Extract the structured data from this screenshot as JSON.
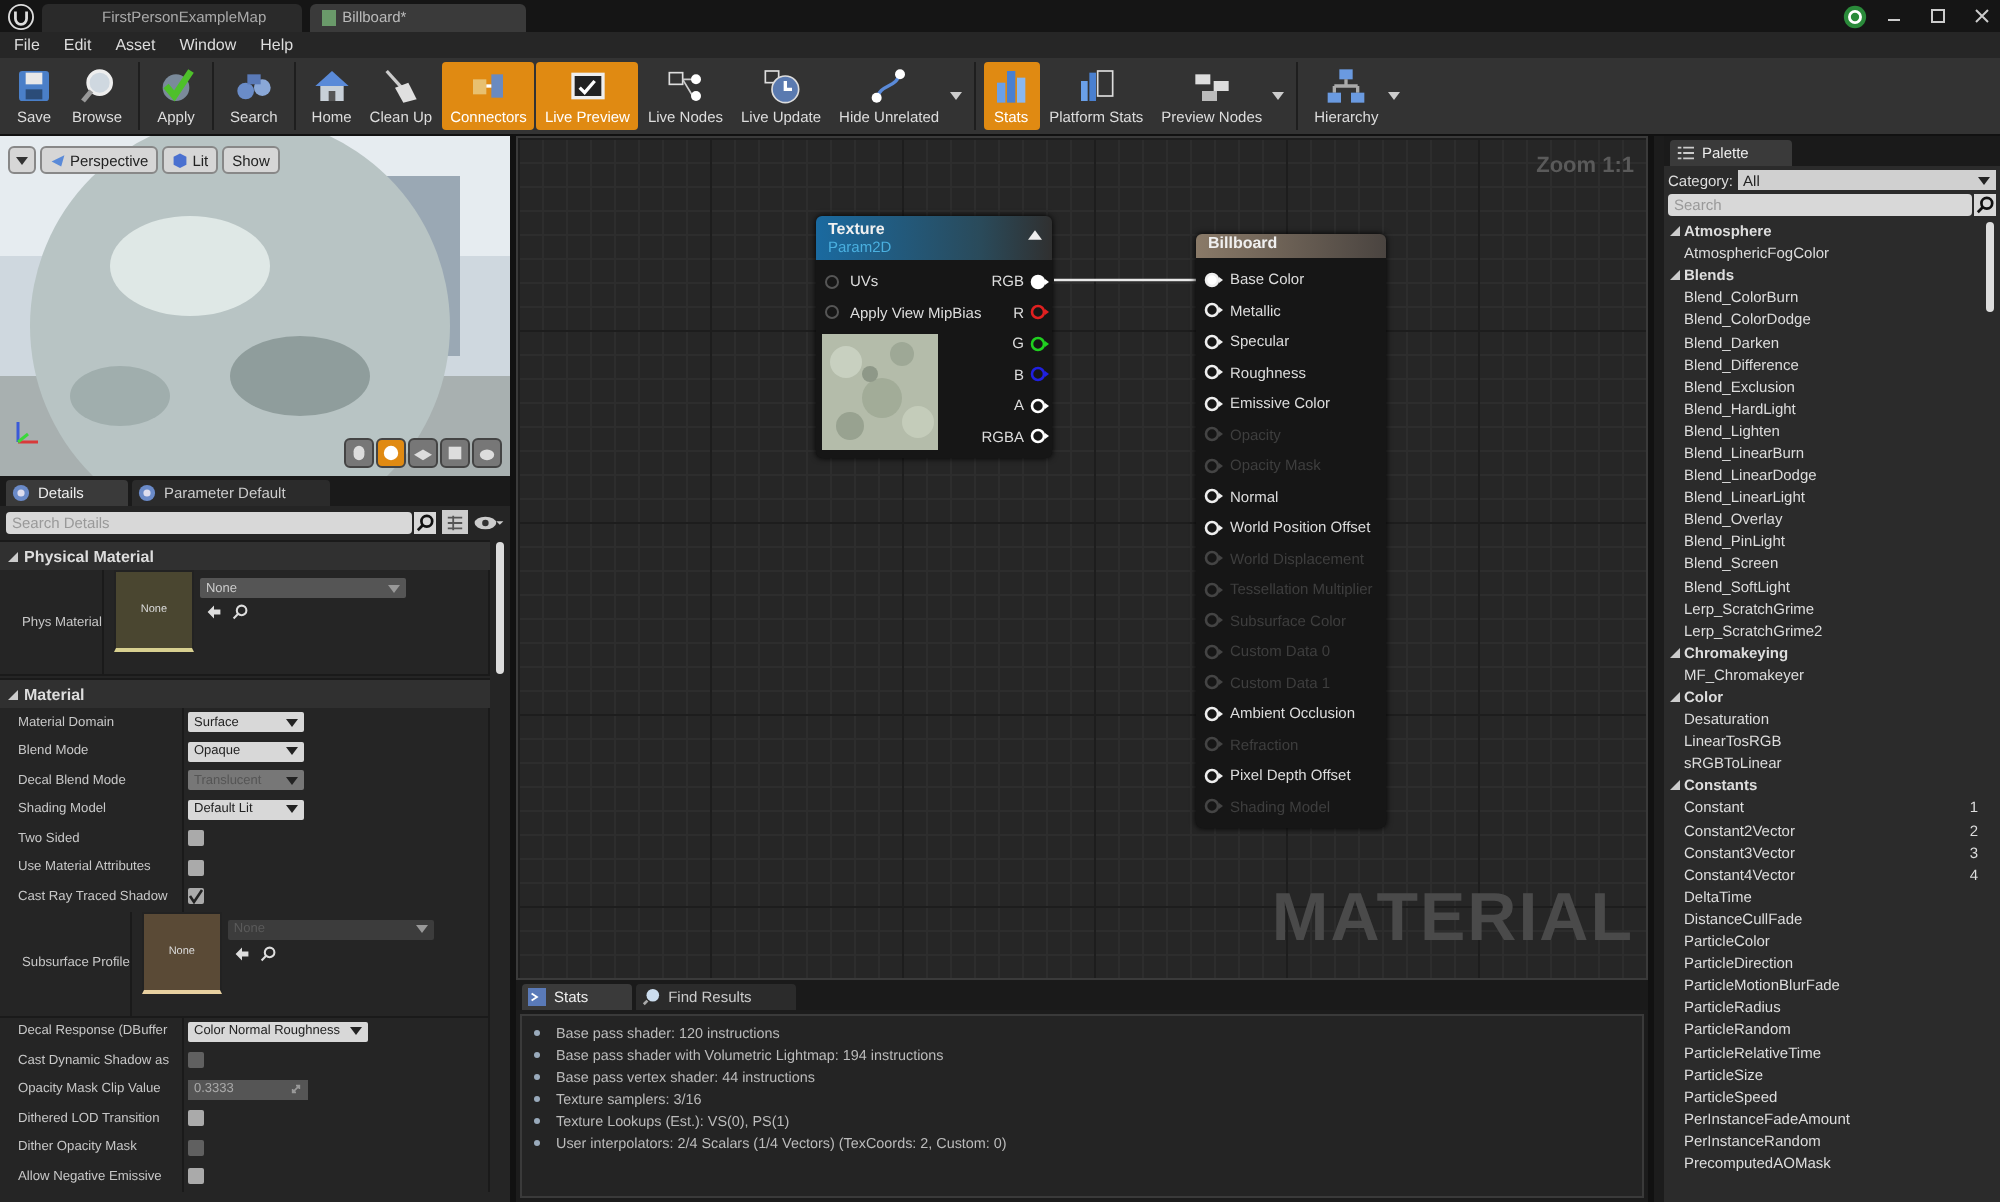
{
  "document_tabs": [
    {
      "label": "FirstPersonExampleMap",
      "selected": false
    },
    {
      "label": "Billboard*",
      "selected": true
    }
  ],
  "menu": [
    "File",
    "Edit",
    "Asset",
    "Window",
    "Help"
  ],
  "toolbar": [
    {
      "items": [
        {
          "label": "Save",
          "active": false,
          "dropdown": false
        },
        {
          "label": "Browse",
          "active": false,
          "dropdown": false
        }
      ]
    },
    {
      "items": [
        {
          "label": "Apply",
          "active": false,
          "dropdown": false
        }
      ]
    },
    {
      "items": [
        {
          "label": "Search",
          "active": false,
          "dropdown": false
        }
      ]
    },
    {
      "items": [
        {
          "label": "Home",
          "active": false,
          "dropdown": false
        },
        {
          "label": "Clean Up",
          "active": false,
          "dropdown": false
        },
        {
          "label": "Connectors",
          "active": true,
          "dropdown": false
        },
        {
          "label": "Live Preview",
          "active": true,
          "dropdown": false
        },
        {
          "label": "Live Nodes",
          "active": false,
          "dropdown": false
        },
        {
          "label": "Live Update",
          "active": false,
          "dropdown": false
        },
        {
          "label": "Hide Unrelated",
          "active": false,
          "dropdown": true
        }
      ]
    },
    {
      "items": [
        {
          "label": "Stats",
          "active": true,
          "dropdown": false
        },
        {
          "label": "Platform Stats",
          "active": false,
          "dropdown": false
        },
        {
          "label": "Preview Nodes",
          "active": false,
          "dropdown": true
        }
      ]
    },
    {
      "items": [
        {
          "label": "Hierarchy",
          "active": false,
          "dropdown": true
        }
      ]
    }
  ],
  "viewport": {
    "buttons": [
      {
        "label": "Perspective"
      },
      {
        "label": "Lit"
      },
      {
        "label": "Show"
      }
    ],
    "preview_shapes": [
      {
        "selected": false
      },
      {
        "selected": true
      },
      {
        "selected": false
      },
      {
        "selected": false
      },
      {
        "selected": false
      }
    ]
  },
  "details": {
    "tabs": [
      {
        "label": "Details",
        "selected": true
      },
      {
        "label": "Parameter Default",
        "selected": false
      }
    ],
    "search": {
      "placeholder": "Search Details"
    },
    "sections": [
      {
        "title": "Physical Material",
        "expanded": true,
        "rows": [
          {
            "label": "Phys Material",
            "kind": "asset",
            "thumbnail": "None",
            "value": "None",
            "disabled": false
          }
        ]
      },
      {
        "title": "Material",
        "expanded": true,
        "rows": [
          {
            "label": "Material Domain",
            "kind": "dropdown",
            "value": "Surface",
            "disabled": false
          },
          {
            "label": "Blend Mode",
            "kind": "dropdown",
            "value": "Opaque",
            "disabled": false
          },
          {
            "label": "Decal Blend Mode",
            "kind": "dropdown",
            "value": "Translucent",
            "disabled": true
          },
          {
            "label": "Shading Model",
            "kind": "dropdown",
            "value": "Default Lit",
            "disabled": false
          },
          {
            "label": "Two Sided",
            "kind": "checkbox",
            "checked": false,
            "disabled": false
          },
          {
            "label": "Use Material Attributes",
            "kind": "checkbox",
            "checked": false,
            "disabled": false
          },
          {
            "label": "Cast Ray Traced Shadow",
            "kind": "checkbox",
            "checked": true,
            "disabled": false
          },
          {
            "label": "Subsurface Profile",
            "kind": "asset",
            "thumbnail": "None",
            "value": "None",
            "disabled": true
          },
          {
            "label": "Decal Response (DBuffer",
            "kind": "dropdown",
            "value": "Color Normal Roughness",
            "disabled": false
          },
          {
            "label": "Cast Dynamic Shadow as",
            "kind": "checkbox",
            "checked": false,
            "disabled": true
          },
          {
            "label": "Opacity Mask Clip Value",
            "kind": "number",
            "value": "0.3333",
            "disabled": true
          },
          {
            "label": "Dithered LOD Transition",
            "kind": "checkbox",
            "checked": false,
            "disabled": false
          },
          {
            "label": "Dither Opacity Mask",
            "kind": "checkbox",
            "checked": false,
            "disabled": true
          },
          {
            "label": "Allow Negative Emissive",
            "kind": "checkbox",
            "checked": false,
            "disabled": false
          }
        ]
      }
    ]
  },
  "graph": {
    "zoom": "Zoom 1:1",
    "watermark": "MATERIAL",
    "texture_node": {
      "title": "Texture",
      "subtitle": "Param2D",
      "inputs": [
        {
          "label": "UVs"
        },
        {
          "label": "Apply View MipBias"
        }
      ],
      "outputs": [
        {
          "label": "RGB",
          "color": "#ffffff",
          "connected": true
        },
        {
          "label": "R",
          "color": "#e02020",
          "connected": false
        },
        {
          "label": "G",
          "color": "#20d020",
          "connected": false
        },
        {
          "label": "B",
          "color": "#2020e0",
          "connected": false
        },
        {
          "label": "A",
          "color": "#ffffff",
          "connected": false
        },
        {
          "label": "RGBA",
          "color": "#ffffff",
          "connected": false
        }
      ]
    },
    "result_node": {
      "title": "Billboard",
      "pins": [
        {
          "label": "Base Color",
          "enabled": true,
          "connected": true
        },
        {
          "label": "Metallic",
          "enabled": true,
          "connected": false
        },
        {
          "label": "Specular",
          "enabled": true,
          "connected": false
        },
        {
          "label": "Roughness",
          "enabled": true,
          "connected": false
        },
        {
          "label": "Emissive Color",
          "enabled": true,
          "connected": false
        },
        {
          "label": "Opacity",
          "enabled": false,
          "connected": false
        },
        {
          "label": "Opacity Mask",
          "enabled": false,
          "connected": false
        },
        {
          "label": "Normal",
          "enabled": true,
          "connected": false
        },
        {
          "label": "World Position Offset",
          "enabled": true,
          "connected": false
        },
        {
          "label": "World Displacement",
          "enabled": false,
          "connected": false
        },
        {
          "label": "Tessellation Multiplier",
          "enabled": false,
          "connected": false
        },
        {
          "label": "Subsurface Color",
          "enabled": false,
          "connected": false
        },
        {
          "label": "Custom Data 0",
          "enabled": false,
          "connected": false
        },
        {
          "label": "Custom Data 1",
          "enabled": false,
          "connected": false
        },
        {
          "label": "Ambient Occlusion",
          "enabled": true,
          "connected": false
        },
        {
          "label": "Refraction",
          "enabled": false,
          "connected": false
        },
        {
          "label": "Pixel Depth Offset",
          "enabled": true,
          "connected": false
        },
        {
          "label": "Shading Model",
          "enabled": false,
          "connected": false
        }
      ]
    }
  },
  "stats": {
    "tabs": [
      {
        "label": "Stats",
        "selected": true
      },
      {
        "label": "Find Results",
        "selected": false
      }
    ],
    "lines": [
      "Base pass shader: 120 instructions",
      "Base pass shader with Volumetric Lightmap: 194 instructions",
      "Base pass vertex shader: 44 instructions",
      "Texture samplers: 3/16",
      "Texture Lookups (Est.): VS(0), PS(1)",
      "User interpolators: 2/4 Scalars (1/4 Vectors) (TexCoords: 2, Custom: 0)"
    ]
  },
  "palette": {
    "tab": "Palette",
    "category_label": "Category:",
    "category": "All",
    "search": {
      "placeholder": "Search"
    },
    "groups": [
      {
        "name": "Atmosphere",
        "expanded": true,
        "items": [
          {
            "label": "AtmosphericFogColor"
          }
        ]
      },
      {
        "name": "Blends",
        "expanded": true,
        "items": [
          {
            "label": "Blend_ColorBurn"
          },
          {
            "label": "Blend_ColorDodge"
          },
          {
            "label": "Blend_Darken"
          },
          {
            "label": "Blend_Difference"
          },
          {
            "label": "Blend_Exclusion"
          },
          {
            "label": "Blend_HardLight"
          },
          {
            "label": "Blend_Lighten"
          },
          {
            "label": "Blend_LinearBurn"
          },
          {
            "label": "Blend_LinearDodge"
          },
          {
            "label": "Blend_LinearLight"
          },
          {
            "label": "Blend_Overlay"
          },
          {
            "label": "Blend_PinLight"
          },
          {
            "label": "Blend_Screen"
          },
          {
            "label": "Blend_SoftLight"
          },
          {
            "label": "Lerp_ScratchGrime"
          },
          {
            "label": "Lerp_ScratchGrime2"
          }
        ]
      },
      {
        "name": "Chromakeying",
        "expanded": true,
        "items": [
          {
            "label": "MF_Chromakeyer"
          }
        ]
      },
      {
        "name": "Color",
        "expanded": true,
        "items": [
          {
            "label": "Desaturation"
          },
          {
            "label": "LinearTosRGB"
          },
          {
            "label": "sRGBToLinear"
          }
        ]
      },
      {
        "name": "Constants",
        "expanded": true,
        "items": [
          {
            "label": "Constant",
            "hotkey": "1"
          },
          {
            "label": "Constant2Vector",
            "hotkey": "2"
          },
          {
            "label": "Constant3Vector",
            "hotkey": "3"
          },
          {
            "label": "Constant4Vector",
            "hotkey": "4"
          },
          {
            "label": "DeltaTime"
          },
          {
            "label": "DistanceCullFade"
          },
          {
            "label": "ParticleColor"
          },
          {
            "label": "ParticleDirection"
          },
          {
            "label": "ParticleMotionBlurFade"
          },
          {
            "label": "ParticleRadius"
          },
          {
            "label": "ParticleRandom"
          },
          {
            "label": "ParticleRelativeTime"
          },
          {
            "label": "ParticleSize"
          },
          {
            "label": "ParticleSpeed"
          },
          {
            "label": "PerInstanceFadeAmount"
          },
          {
            "label": "PerInstanceRandom"
          },
          {
            "label": "PrecomputedAOMask"
          }
        ]
      }
    ]
  }
}
